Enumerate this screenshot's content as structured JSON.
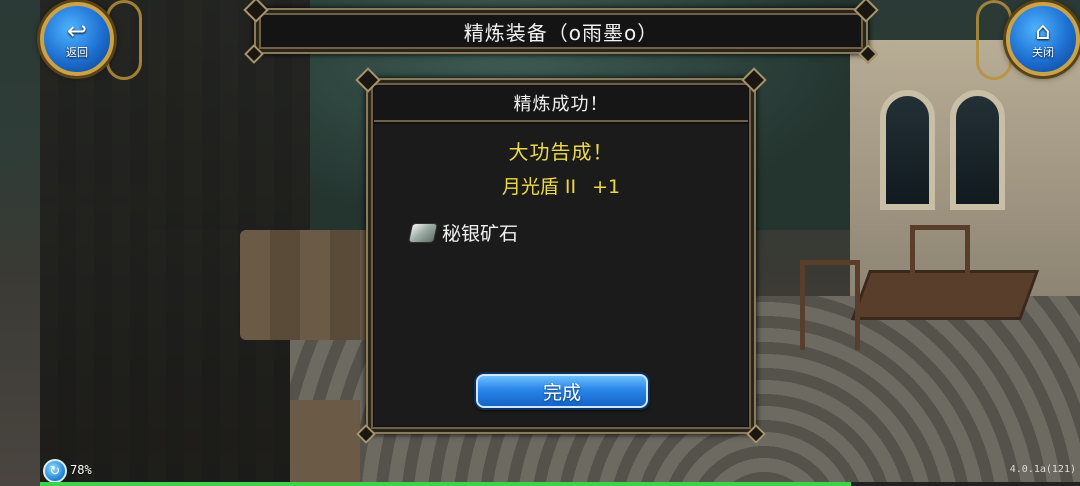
{
  "header": {
    "title": "精炼装备（o雨墨o）"
  },
  "nav": {
    "back": {
      "icon": "back-arrow-icon",
      "label": "返回"
    },
    "close": {
      "icon": "home-icon",
      "label": "关闭"
    }
  },
  "result_dialog": {
    "title": "精炼成功！",
    "success_message": "大功告成！",
    "item_name": "月光盾 II",
    "item_level": "+1",
    "material": {
      "icon": "ore-icon",
      "name": "秘银矿石"
    },
    "done_label": "完成"
  },
  "status": {
    "battery_text": "78%",
    "battery_value": 0.78,
    "version": "4.0.1a(121)"
  },
  "colors": {
    "accent_yellow": "#ecd94a",
    "button_blue": "#2a86e8",
    "frame_gold": "#a8956b"
  }
}
